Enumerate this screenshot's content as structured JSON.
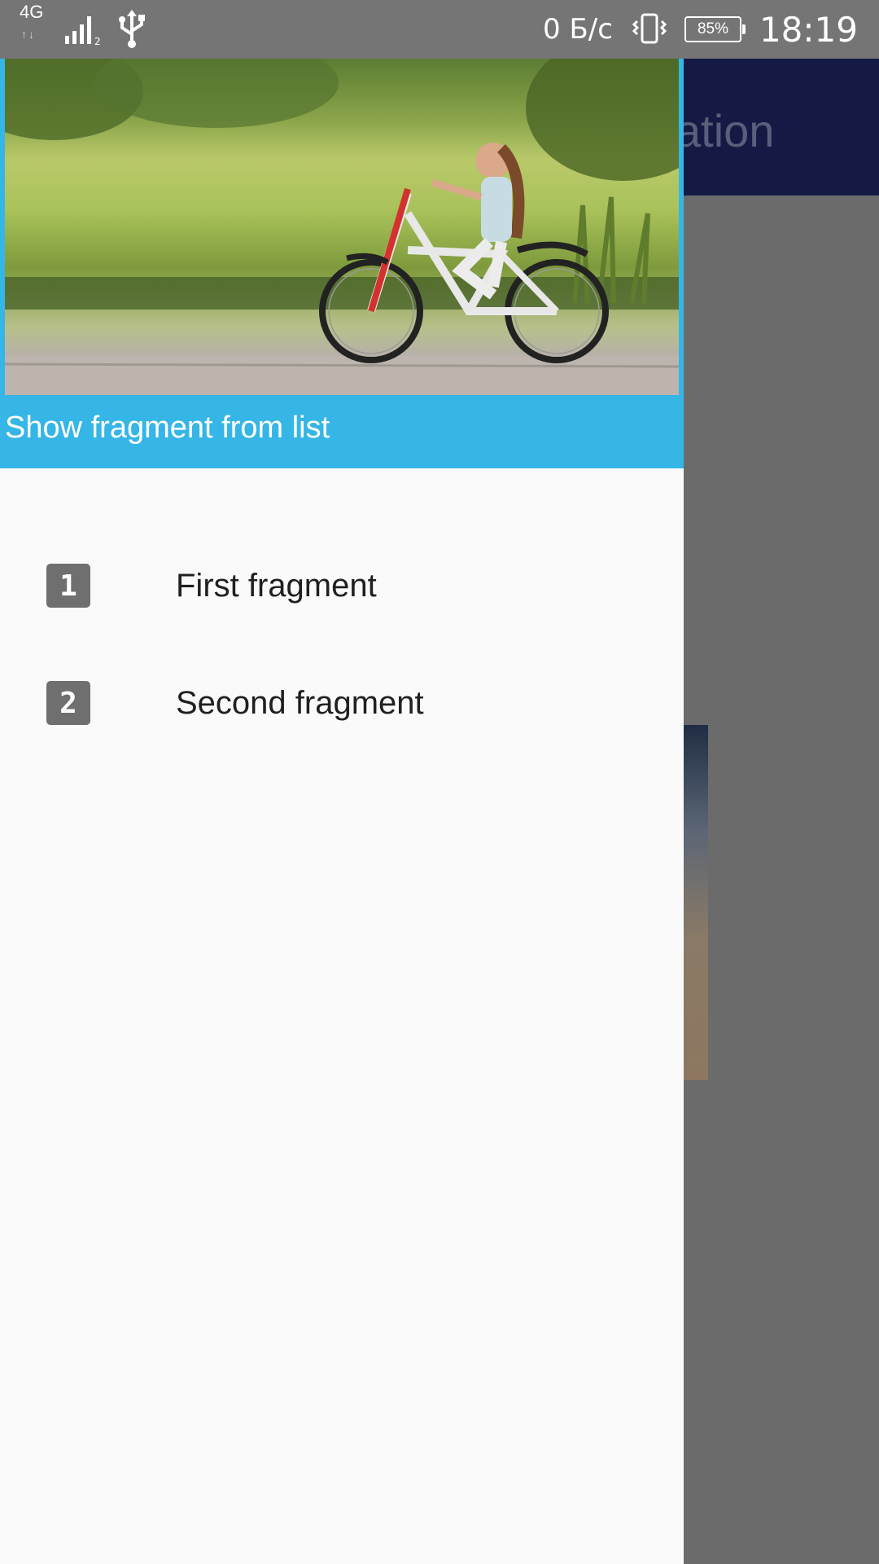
{
  "status_bar": {
    "network_type": "4G",
    "network_arrows": "↑↓",
    "signal_sub": "2",
    "speed": "0 Б/с",
    "battery": "85%",
    "time": "18:19",
    "icons": [
      "network-4g-icon",
      "signal-icon",
      "usb-icon",
      "vibrate-icon",
      "battery-icon"
    ]
  },
  "background": {
    "toolbar_title_partial": "ation",
    "toolbar_color": "#141a44"
  },
  "drawer": {
    "header_title": "Show fragment from list",
    "header_color": "#35b6e6",
    "header_image": "girl-riding-bicycle-photo",
    "items": [
      {
        "icon": "number-1-icon",
        "icon_text": "1",
        "label": "First fragment"
      },
      {
        "icon": "number-2-icon",
        "icon_text": "2",
        "label": "Second fragment"
      }
    ]
  }
}
